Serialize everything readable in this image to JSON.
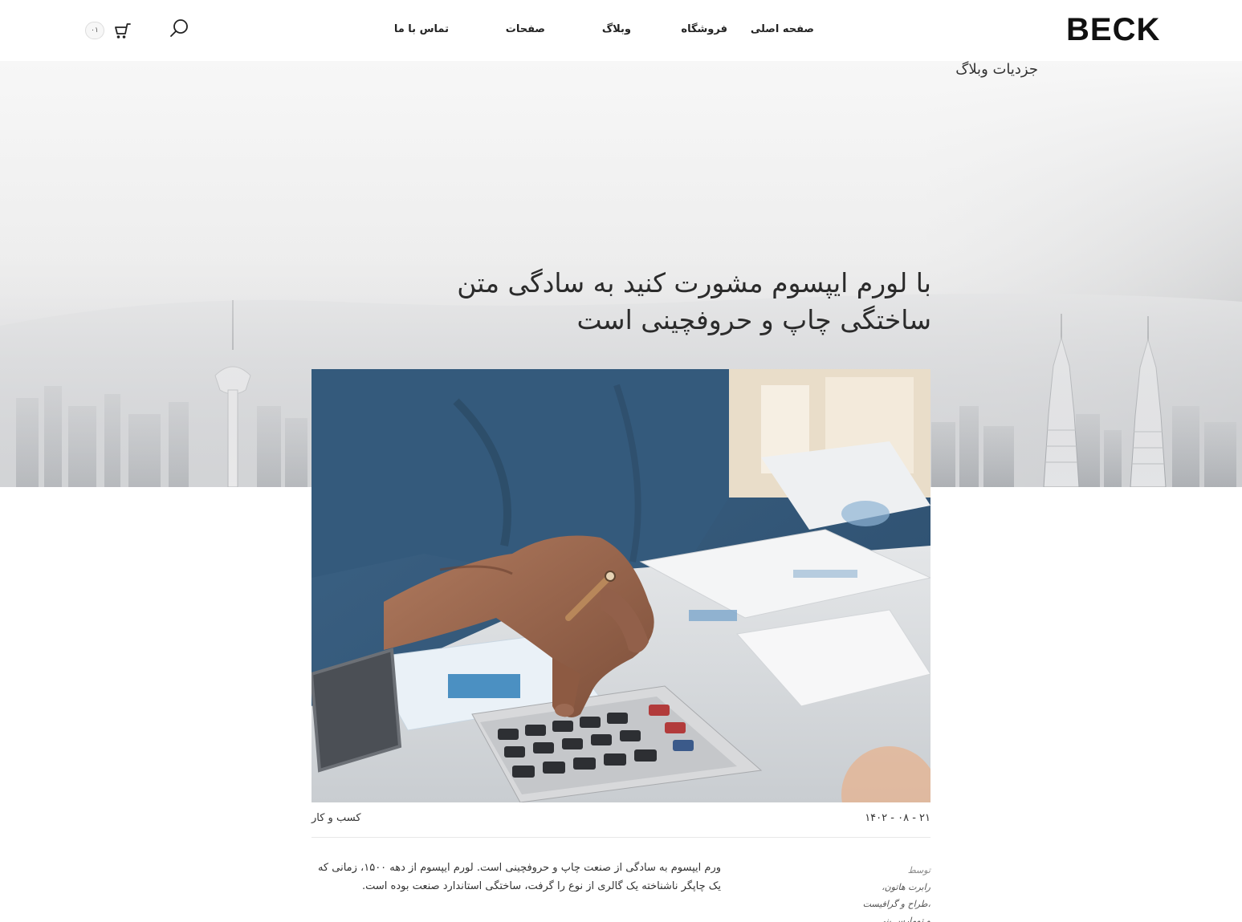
{
  "header": {
    "logo": "BECK",
    "nav": {
      "home": "صفحه اصلی",
      "shop": "فروشگاه",
      "blog": "وبلاگ",
      "pages": "صفحات",
      "contact": "تماس با ما"
    },
    "icons": {
      "search": "search-icon",
      "cart": "cart-icon"
    },
    "cart_count": "۰۱"
  },
  "hero": {
    "breadcrumb": "جزدیات وبلاگ",
    "title": "با لورم ایپسوم مشورت کنید به سادگی متن ساختگی چاپ و حروفچینی است"
  },
  "post": {
    "date": "۲۱ - ۰۸ - ۱۴۰۲",
    "category": "کسب و کار",
    "author": {
      "label": "توسط",
      "lines": [
        "رابرت هاتون،",
        "،طراح و گرافیست",
        "و تومارس بنی"
      ]
    },
    "body": "ورم ایپسوم به سادگی از صنعت چاپ و حروفچینی است. لورم ایپسوم از دهه ۱۵۰۰، زمانی که یک چاپگر ناشناخته یک گالری از نوع را گرفت، ساختگی استاندارد صنعت بوده است."
  },
  "colors": {
    "text": "#222222",
    "hero_top": "#f6f6f6",
    "hero_bottom": "#c2c4c6",
    "divider": "#e8e8e8"
  }
}
